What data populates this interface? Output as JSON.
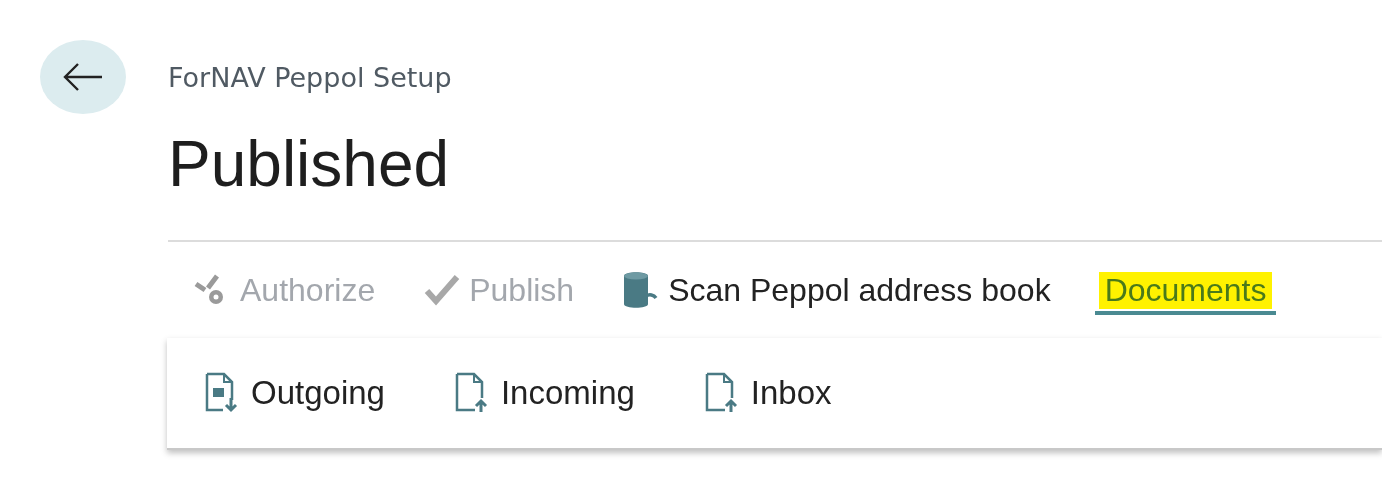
{
  "breadcrumb": "ForNAV Peppol Setup",
  "title": "Published",
  "actions": [
    {
      "label": "Authorize",
      "kind": "gear",
      "disabled": true,
      "selected": false,
      "highlighted": false
    },
    {
      "label": "Publish",
      "kind": "check",
      "disabled": true,
      "selected": false,
      "highlighted": false
    },
    {
      "label": "Scan Peppol address book",
      "kind": "database",
      "disabled": false,
      "selected": false,
      "highlighted": false
    },
    {
      "label": "Documents",
      "kind": "menu",
      "disabled": false,
      "selected": true,
      "highlighted": true
    }
  ],
  "submenu": [
    {
      "label": "Outgoing",
      "kind": "outgoing"
    },
    {
      "label": "Incoming",
      "kind": "incoming"
    },
    {
      "label": "Inbox",
      "kind": "incoming"
    }
  ]
}
